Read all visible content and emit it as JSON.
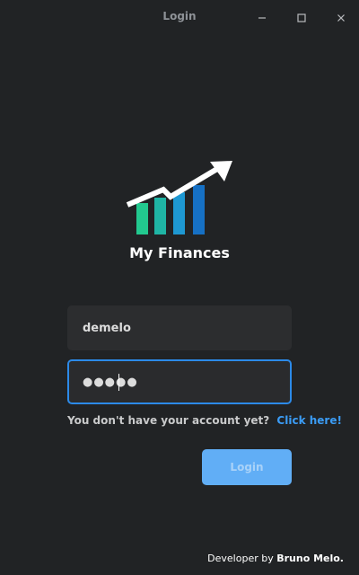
{
  "window": {
    "title": "Login",
    "controls": {
      "minimize_icon": "minimize-icon",
      "maximize_icon": "maximize-icon",
      "close_icon": "close-icon"
    }
  },
  "logo": {
    "icon": "finance-growth-chart-icon",
    "app_name": "My Finances"
  },
  "form": {
    "username": {
      "value": "demelo"
    },
    "password": {
      "masked_value": "●●●●●"
    },
    "signup_prompt": "You don't have your account yet?",
    "signup_link": "Click here!",
    "login_label": "Login"
  },
  "footer": {
    "prefix": "Developer by ",
    "author": "Bruno Melo."
  },
  "colors": {
    "background": "#212325",
    "field_bg": "#2c2d2f",
    "focus_border": "#2c8ae8",
    "link": "#3b9cf5",
    "button": "#61aef6",
    "bar_green": "#22c98f",
    "bar_teal": "#1aa4c9",
    "bar_blue": "#1e88d6",
    "bar_blue_dark": "#1670c4"
  }
}
